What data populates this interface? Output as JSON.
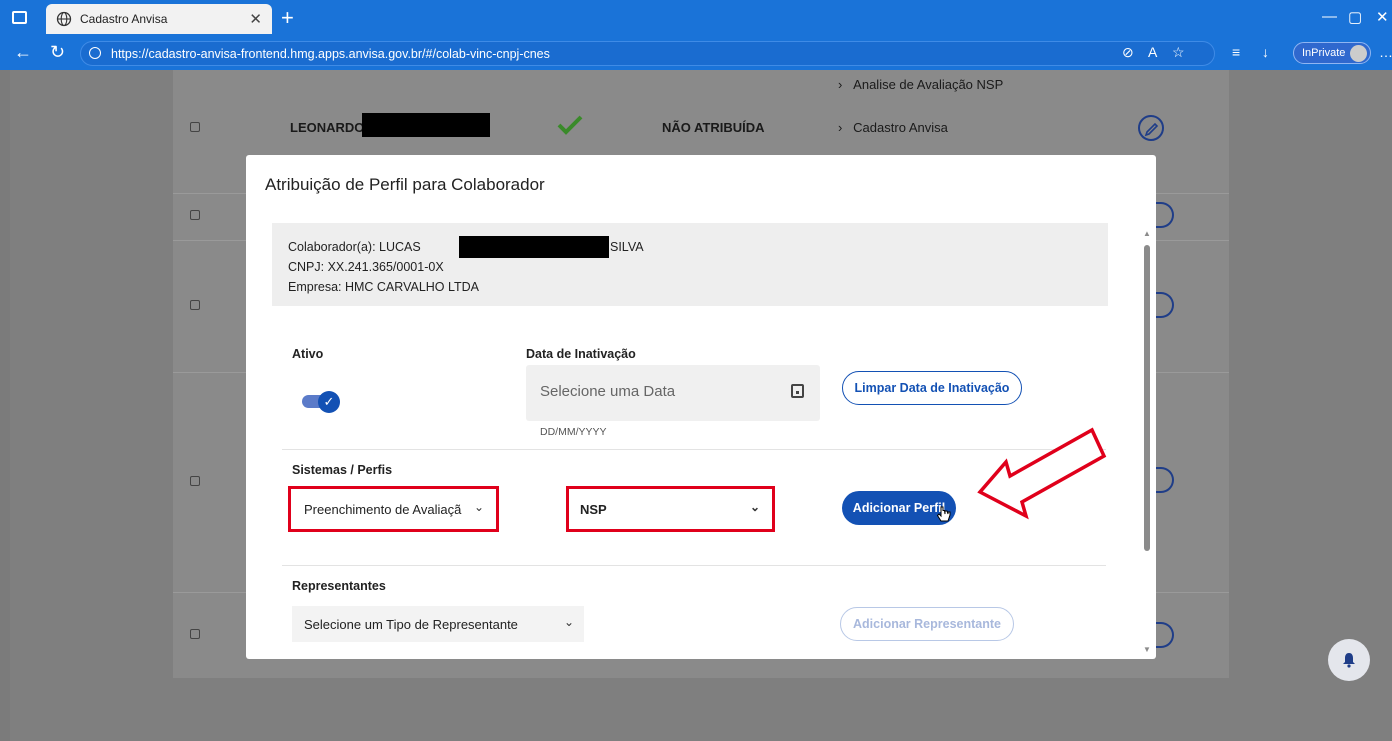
{
  "browser": {
    "tab_title": "Cadastro Anvisa",
    "url": "https://cadastro-anvisa-frontend.hmg.apps.anvisa.gov.br/#/colab-vinc-cnpj-cnes",
    "inprivate_label": "InPrivate"
  },
  "background": {
    "row_name": "LEONARDO",
    "row_status": "NÃO ATRIBUÍDA",
    "links": [
      "Analise de Avaliação NSP",
      "Cadastro Anvisa"
    ]
  },
  "modal": {
    "title": "Atribuição de Perfil para Colaborador",
    "colaborador_prefix": "Colaborador(a): LUCAS",
    "colaborador_suffix": "SILVA",
    "cnpj": "CNPJ: XX.241.365/0001-0X",
    "empresa": "Empresa: HMC CARVALHO LTDA",
    "ativo_label": "Ativo",
    "data_inativacao_label": "Data de Inativação",
    "date_placeholder": "Selecione uma Data",
    "date_hint": "DD/MM/YYYY",
    "limpar_button": "Limpar Data de Inativação",
    "sistemas_label": "Sistemas / Perfis",
    "sistema_select_value": "Preenchimento de Avaliaçã",
    "perfil_select_value": "NSP",
    "adicionar_perfil_button": "Adicionar Perfil",
    "representantes_label": "Representantes",
    "representante_select_value": "Selecione um Tipo de Representante",
    "adicionar_representante_button": "Adicionar Representante"
  },
  "colors": {
    "primary": "#1351b4",
    "annotation_red": "#e0001b",
    "browser_blue": "#1a73d8"
  }
}
